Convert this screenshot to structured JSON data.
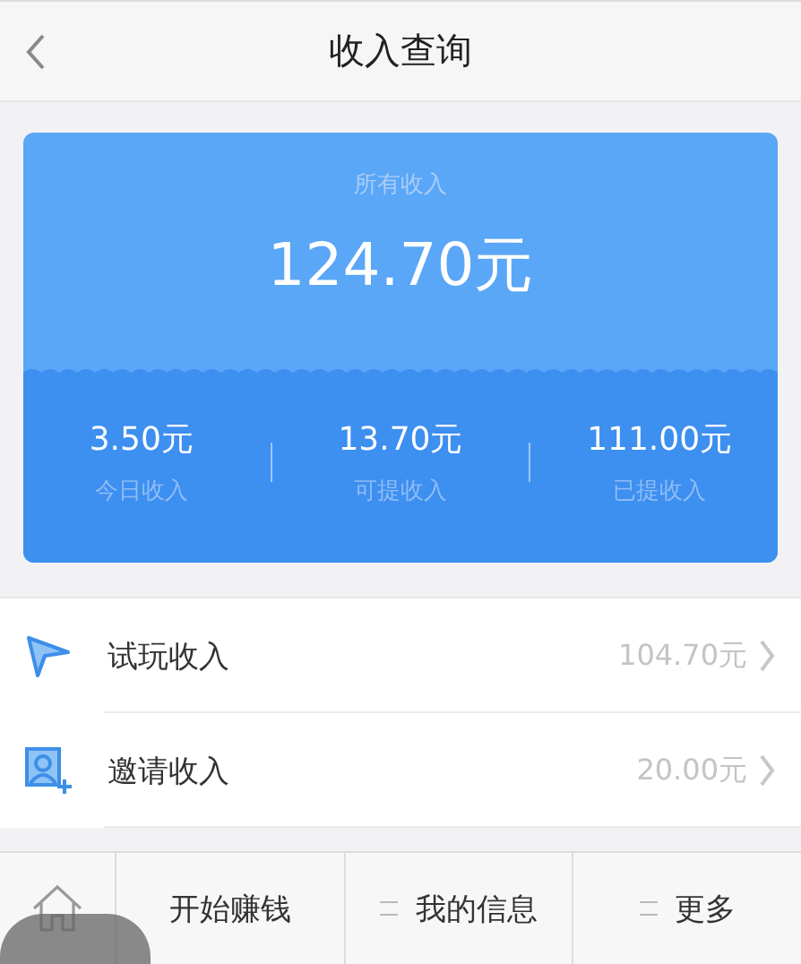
{
  "header": {
    "title": "收入查询"
  },
  "summary": {
    "label": "所有收入",
    "total": "124.70元",
    "stats": [
      {
        "value": "3.50元",
        "label": "今日收入"
      },
      {
        "value": "13.70元",
        "label": "可提收入"
      },
      {
        "value": "111.00元",
        "label": "已提收入"
      }
    ]
  },
  "items": [
    {
      "kind": "trial",
      "label": "试玩收入",
      "amount": "104.70元"
    },
    {
      "kind": "invite",
      "label": "邀请收入",
      "amount": "20.00元"
    }
  ],
  "tabbar": [
    {
      "kind": "home"
    },
    {
      "kind": "text",
      "label": "开始赚钱",
      "has_menu": false
    },
    {
      "kind": "text",
      "label": "我的信息",
      "has_menu": true
    },
    {
      "kind": "text",
      "label": "更多",
      "has_menu": true
    }
  ]
}
